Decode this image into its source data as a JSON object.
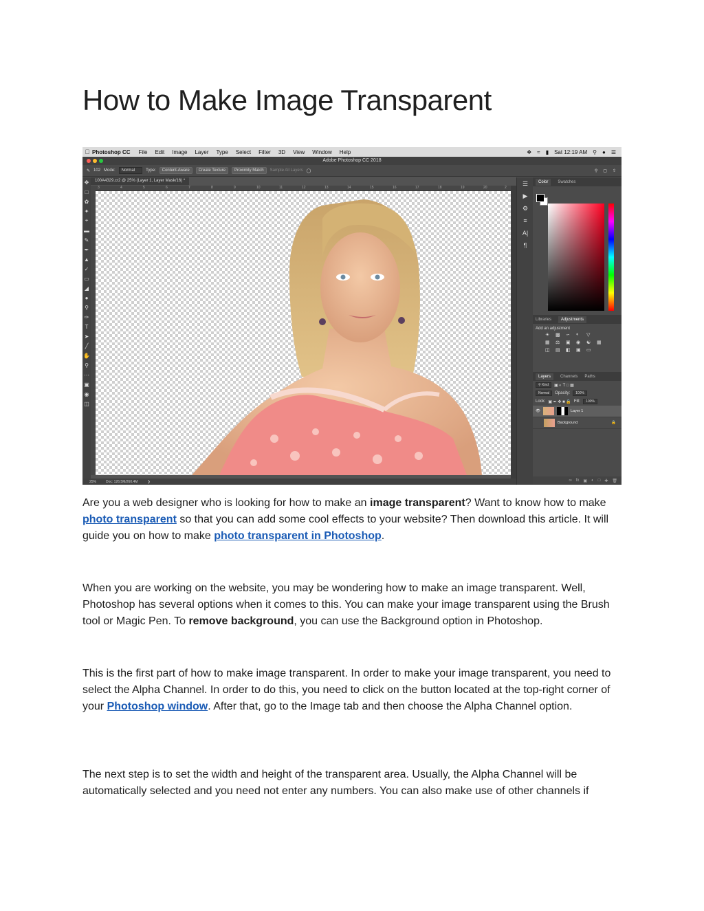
{
  "title": "How to Make Image Transparent",
  "screenshot": {
    "mac_menu": {
      "app": "Photoshop CC",
      "items": [
        "File",
        "Edit",
        "Image",
        "Layer",
        "Type",
        "Select",
        "Filter",
        "3D",
        "View",
        "Window",
        "Help"
      ],
      "clock": "Sat 12:19 AM"
    },
    "window_title": "Adobe Photoshop CC 2018",
    "options_bar": {
      "brush_size": "102",
      "mode_label": "Mode:",
      "mode_value": "Normal",
      "type_label": "Type:",
      "content_aware": "Content-Aware",
      "create_texture": "Create Texture",
      "proximity_match": "Proximity Match",
      "sample_all_layers": "Sample All Layers"
    },
    "doc_tab": "100A4329.cr2 @ 25% (Layer 1, Layer Mask/16) *",
    "ruler_ticks": [
      "3",
      "4",
      "5",
      "6",
      "7",
      "8",
      "9",
      "10",
      "11",
      "12",
      "13",
      "14",
      "15",
      "16",
      "17",
      "18",
      "19",
      "20",
      "2"
    ],
    "status": {
      "zoom": "25%",
      "doc": "Doc: 126.5M/260.4M"
    },
    "color_panel": {
      "tabs": [
        "Color",
        "Swatches"
      ]
    },
    "adjustments_panel": {
      "tabs": [
        "Libraries",
        "Adjustments"
      ],
      "title": "Add an adjustment"
    },
    "layers_panel": {
      "tabs": [
        "Layers",
        "Channels",
        "Paths"
      ],
      "kind": "Kind",
      "blend_mode": "Normal",
      "opacity_label": "Opacity:",
      "opacity_value": "100%",
      "lock_label": "Lock:",
      "fill_label": "Fill:",
      "fill_value": "100%",
      "layers": [
        "Layer 1",
        "Background"
      ]
    },
    "colors": {
      "ps_bg": "#535353",
      "hue_red": "#ff0022"
    }
  },
  "paragraphs": {
    "p1": {
      "t1": "Are you a web designer who is looking for how to make an ",
      "b1": "image transparent",
      "t2": "? Want to know how to make ",
      "l1": "photo transparent",
      "t3": " so that you can add some cool effects to your website? Then download this article. It will guide you on how to make ",
      "l2": "photo transparent in Photoshop",
      "t4": "."
    },
    "p2": {
      "t1": "When you are working on the website, you may be wondering how to make an image transparent. Well, Photoshop has several options when it comes to this. You can make your image transparent using the Brush tool or Magic Pen. To ",
      "b1": "remove background",
      "t2": ", you can use the Background option in Photoshop."
    },
    "p3": {
      "t1": "This is the first part of how to make image transparent. In order to make your image transparent, you need to select the Alpha Channel. In order to do this, you need to click on the button located at the top-right corner of your ",
      "l1": "Photoshop window",
      "t2": ". After that, go to the Image tab and then choose the Alpha Channel option."
    },
    "p4": {
      "t1": "The next step is to set the width and height of the transparent area. Usually, the Alpha Channel will be automatically selected and you need not enter any numbers. You can also make use of other channels if"
    }
  }
}
